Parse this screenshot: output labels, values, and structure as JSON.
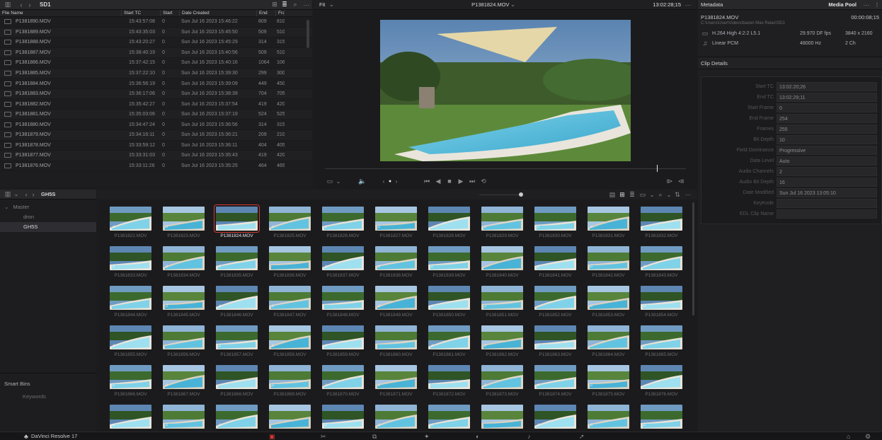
{
  "filelist": {
    "bin_name": "SD1",
    "columns": [
      "File Name",
      "Start TC",
      "Start",
      "Date Created",
      "End",
      "Fram"
    ],
    "rows": [
      {
        "name": "P1381890.MOV",
        "start_tc": "15:43:57:08",
        "start": "0",
        "date": "Sun Jul 16 2023 15:46:22",
        "end": "809",
        "frames": "810"
      },
      {
        "name": "P1381889.MOV",
        "start_tc": "15:43:35:03",
        "start": "0",
        "date": "Sun Jul 16 2023 15:45:50",
        "end": "509",
        "frames": "510"
      },
      {
        "name": "P1381888.MOV",
        "start_tc": "15:43:20:27",
        "start": "0",
        "date": "Sun Jul 16 2023 15:45:29",
        "end": "314",
        "frames": "315"
      },
      {
        "name": "P1381887.MOV",
        "start_tc": "15:38:40:19",
        "start": "0",
        "date": "Sun Jul 16 2023 15:40:56",
        "end": "509",
        "frames": "510"
      },
      {
        "name": "P1381886.MOV",
        "start_tc": "15:37:42:15",
        "start": "0",
        "date": "Sun Jul 16 2023 15:40:16",
        "end": "1064",
        "frames": "106"
      },
      {
        "name": "P1381885.MOV",
        "start_tc": "15:37:22:10",
        "start": "0",
        "date": "Sun Jul 16 2023 15:39:30",
        "end": "299",
        "frames": "300"
      },
      {
        "name": "P1381884.MOV",
        "start_tc": "15:36:56:19",
        "start": "0",
        "date": "Sun Jul 16 2023 15:39:09",
        "end": "449",
        "frames": "450"
      },
      {
        "name": "P1381883.MOV",
        "start_tc": "15:36:17:06",
        "start": "0",
        "date": "Sun Jul 16 2023 15:38:39",
        "end": "704",
        "frames": "705"
      },
      {
        "name": "P1381882.MOV",
        "start_tc": "15:35:42:27",
        "start": "0",
        "date": "Sun Jul 16 2023 15:37:54",
        "end": "419",
        "frames": "420"
      },
      {
        "name": "P1381881.MOV",
        "start_tc": "15:35:03:06",
        "start": "0",
        "date": "Sun Jul 16 2023 15:37:19",
        "end": "524",
        "frames": "525"
      },
      {
        "name": "P1381880.MOV",
        "start_tc": "15:34:47:24",
        "start": "0",
        "date": "Sun Jul 16 2023 15:36:56",
        "end": "314",
        "frames": "315"
      },
      {
        "name": "P1381879.MOV",
        "start_tc": "15:34:16:11",
        "start": "0",
        "date": "Sun Jul 16 2023 15:36:21",
        "end": "209",
        "frames": "210"
      },
      {
        "name": "P1381878.MOV",
        "start_tc": "15:33:59:12",
        "start": "0",
        "date": "Sun Jul 16 2023 15:36:11",
        "end": "404",
        "frames": "405"
      },
      {
        "name": "P1381877.MOV",
        "start_tc": "15:33:31:03",
        "start": "0",
        "date": "Sun Jul 16 2023 15:35:43",
        "end": "419",
        "frames": "420"
      },
      {
        "name": "P1381876.MOV",
        "start_tc": "15:33:11:26",
        "start": "0",
        "date": "Sun Jul 16 2023 15:35:25",
        "end": "464",
        "frames": "465"
      }
    ]
  },
  "viewer": {
    "zoom": "Fit",
    "clip_title": "P1381824.MOV",
    "timecode": "13:02:28;15",
    "playhead_fraction": 0.92
  },
  "metadata_panel": {
    "title": "Metadata",
    "media_pool_label": "Media Pool",
    "clip_name": "P1381824.MOV",
    "duration": "00:00:08;15",
    "path": "C:\\Users\\User\\Videos\\bazen Max Relax\\SD1",
    "video_codec": "H.264 High 4:2:2 L5.1",
    "video_fps": "29.970 DF fps",
    "video_res": "3840 x 2160",
    "audio_codec": "Linear PCM",
    "audio_rate": "48000 Hz",
    "audio_ch": "2 Ch",
    "section": "Clip Details",
    "fields": [
      {
        "label": "Start TC",
        "value": "13:02:20;26"
      },
      {
        "label": "End TC",
        "value": "13:02:29;11"
      },
      {
        "label": "Start Frame",
        "value": "0"
      },
      {
        "label": "End Frame",
        "value": "254"
      },
      {
        "label": "Frames",
        "value": "255"
      },
      {
        "label": "Bit Depth",
        "value": "10"
      },
      {
        "label": "Field Dominance",
        "value": "Progressive"
      },
      {
        "label": "Data Level",
        "value": "Auto"
      },
      {
        "label": "Audio Channels",
        "value": "2"
      },
      {
        "label": "Audio Bit Depth",
        "value": "16"
      },
      {
        "label": "Date Modified",
        "value": "Sun Jul 16 2023 13:05:10"
      },
      {
        "label": "KeyKode",
        "value": ""
      },
      {
        "label": "EDL Clip Name",
        "value": ""
      }
    ]
  },
  "bins": {
    "current": "GH5S",
    "tree": [
      {
        "label": "Master"
      },
      {
        "label": "dron"
      },
      {
        "label": "GH5S"
      }
    ],
    "smart_bins": "Smart Bins",
    "keywords": "Keywords"
  },
  "media": {
    "selected_index": 2,
    "thumbs": [
      "P1381822.MOV",
      "P1381823.MOV",
      "P1381824.MOV",
      "P1381825.MOV",
      "P1381826.MOV",
      "P1381827.MOV",
      "P1381828.MOV",
      "P1381829.MOV",
      "P1381830.MOV",
      "P1381831.MOV",
      "P1381832.MOV",
      "P1381833.MOV",
      "P1381834.MOV",
      "P1381835.MOV",
      "P1381836.MOV",
      "P1381837.MOV",
      "P1381838.MOV",
      "P1381839.MOV",
      "P1381840.MOV",
      "P1381841.MOV",
      "P1381842.MOV",
      "P1381843.MOV",
      "P1381844.MOV",
      "P1381845.MOV",
      "P1381846.MOV",
      "P1381847.MOV",
      "P1381848.MOV",
      "P1381849.MOV",
      "P1381850.MOV",
      "P1381851.MOV",
      "P1381852.MOV",
      "P1381853.MOV",
      "P1381854.MOV",
      "P1381855.MOV",
      "P1381856.MOV",
      "P1381857.MOV",
      "P1381858.MOV",
      "P1381859.MOV",
      "P1381860.MOV",
      "P1381861.MOV",
      "P1381862.MOV",
      "P1381863.MOV",
      "P1381864.MOV",
      "P1381865.MOV",
      "P1381866.MOV",
      "P1381867.MOV",
      "P1381868.MOV",
      "P1381869.MOV",
      "P1381870.MOV",
      "P1381871.MOV",
      "P1381872.MOV",
      "P1381873.MOV",
      "P1381874.MOV",
      "P1381875.MOV",
      "P1381876.MOV",
      "",
      "",
      "",
      "",
      "",
      "",
      "",
      "",
      "",
      "",
      ""
    ]
  },
  "bottombar": {
    "app_name": "DaVinci Resolve 17",
    "pages": [
      "media-icon",
      "cut-icon",
      "edit-icon",
      "fusion-icon",
      "color-icon",
      "fairlight-icon",
      "deliver-icon"
    ]
  },
  "colors": {
    "selected": "#d23a34",
    "accent": "#e4e4e8"
  }
}
